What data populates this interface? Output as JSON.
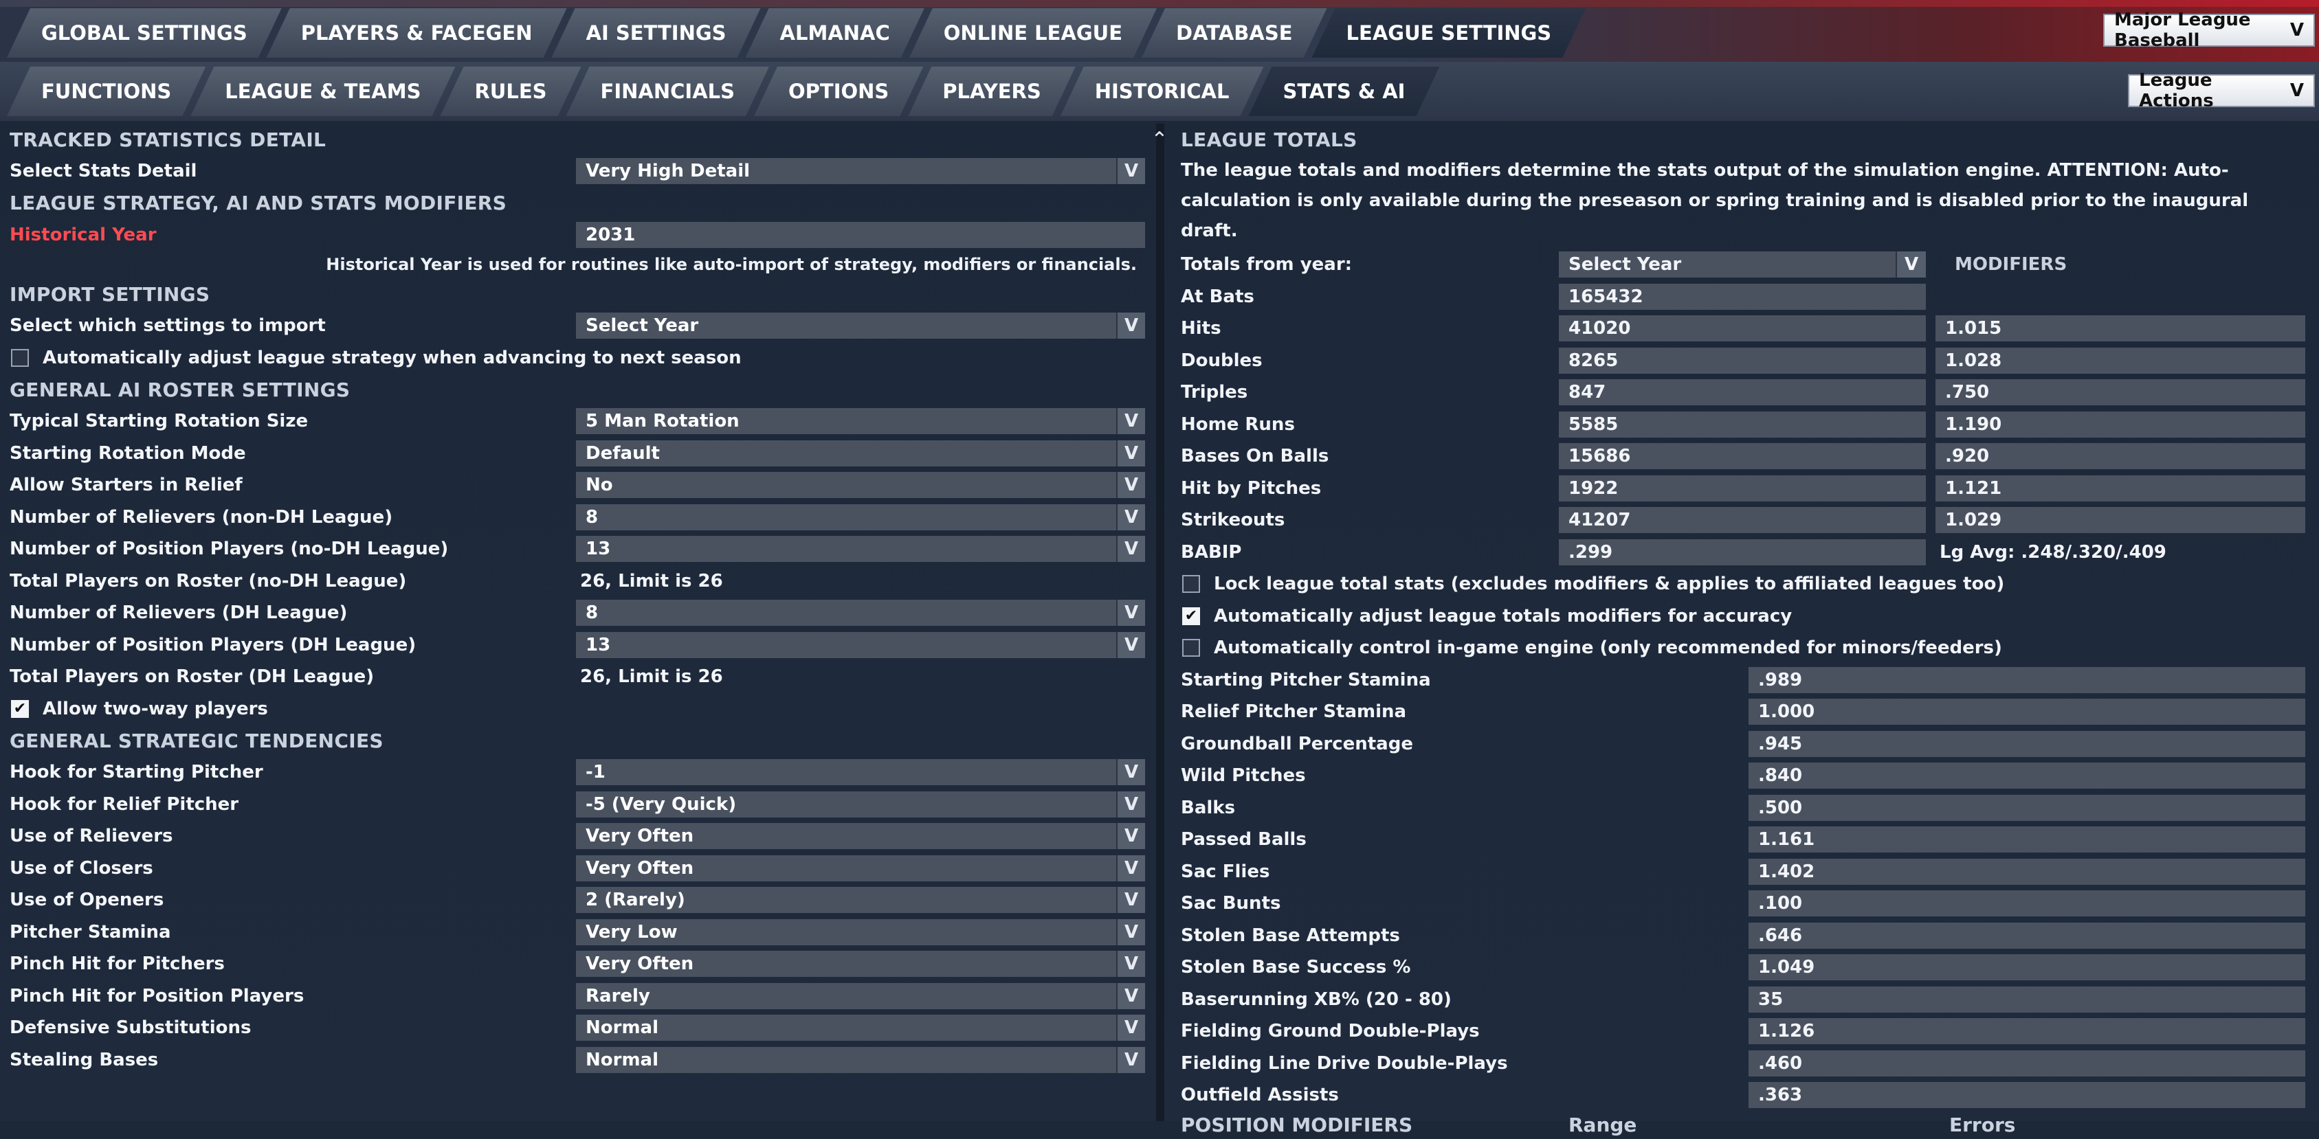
{
  "top_tabs": [
    "GLOBAL SETTINGS",
    "PLAYERS & FACEGEN",
    "AI SETTINGS",
    "ALMANAC",
    "ONLINE LEAGUE",
    "DATABASE",
    "LEAGUE SETTINGS"
  ],
  "sub_tabs": [
    "FUNCTIONS",
    "LEAGUE & TEAMS",
    "RULES",
    "FINANCIALS",
    "OPTIONS",
    "PLAYERS",
    "HISTORICAL",
    "STATS & AI"
  ],
  "league_select": {
    "value": "Major League Baseball",
    "chevron": "V"
  },
  "league_actions": {
    "label": "League Actions",
    "chevron": "V"
  },
  "left": {
    "tracked_title": "TRACKED STATISTICS DETAIL",
    "stats_detail": {
      "label": "Select Stats Detail",
      "value": "Very High Detail"
    },
    "strategy_title": "LEAGUE STRATEGY, AI AND STATS MODIFIERS",
    "historical_year": {
      "label": "Historical Year",
      "value": "2031"
    },
    "historical_note": "Historical Year is used for routines like auto-import of strategy, modifiers or financials.",
    "import_title": "IMPORT SETTINGS",
    "import_select": {
      "label": "Select which settings to import",
      "value": "Select Year"
    },
    "auto_adjust": "Automatically adjust league strategy when advancing to next season",
    "roster_title": "GENERAL AI ROSTER SETTINGS",
    "roster_rows": [
      {
        "label": "Typical Starting Rotation Size",
        "value": "5 Man Rotation",
        "dd": true
      },
      {
        "label": "Starting Rotation Mode",
        "value": "Default",
        "dd": true
      },
      {
        "label": "Allow Starters in Relief",
        "value": "No",
        "dd": true
      },
      {
        "label": "Number of Relievers (non-DH League)",
        "value": "8",
        "dd": true
      },
      {
        "label": "Number of Position Players (no-DH League)",
        "value": "13",
        "dd": true
      },
      {
        "label": "Total Players on Roster (no-DH League)",
        "value": "26, Limit is 26",
        "dd": false
      },
      {
        "label": "Number of Relievers (DH League)",
        "value": "8",
        "dd": true
      },
      {
        "label": "Number of Position Players (DH League)",
        "value": "13",
        "dd": true
      },
      {
        "label": "Total Players on Roster (DH League)",
        "value": "26, Limit is 26",
        "dd": false
      }
    ],
    "two_way": "Allow two-way players",
    "tendencies_title": "GENERAL STRATEGIC TENDENCIES",
    "tendency_rows": [
      {
        "label": "Hook for Starting Pitcher",
        "value": "-1"
      },
      {
        "label": "Hook for Relief Pitcher",
        "value": "-5 (Very Quick)"
      },
      {
        "label": "Use of Relievers",
        "value": "Very Often"
      },
      {
        "label": "Use of Closers",
        "value": "Very Often"
      },
      {
        "label": "Use of Openers",
        "value": "2 (Rarely)"
      },
      {
        "label": "Pitcher Stamina",
        "value": "Very Low"
      },
      {
        "label": "Pinch Hit for Pitchers",
        "value": "Very Often"
      },
      {
        "label": "Pinch Hit for Position Players",
        "value": "Rarely"
      },
      {
        "label": "Defensive Substitutions",
        "value": "Normal"
      },
      {
        "label": "Stealing Bases",
        "value": "Normal"
      }
    ],
    "dd_arrow": "V"
  },
  "right": {
    "totals_title": "LEAGUE TOTALS",
    "totals_desc": "The league totals and modifiers determine the stats output of the simulation engine. ATTENTION: Auto-calculation is only available during the preseason or spring training and is disabled prior to the inaugural draft.",
    "totals_from": {
      "label": "Totals from year:",
      "value": "Select Year"
    },
    "modifiers_header": "MODIFIERS",
    "at_bats": {
      "label": "At Bats",
      "value": "165432"
    },
    "total_rows": [
      {
        "label": "Hits",
        "value": "41020",
        "mod": "1.015"
      },
      {
        "label": "Doubles",
        "value": "8265",
        "mod": "1.028"
      },
      {
        "label": "Triples",
        "value": "847",
        "mod": ".750"
      },
      {
        "label": "Home Runs",
        "value": "5585",
        "mod": "1.190"
      },
      {
        "label": "Bases On Balls",
        "value": "15686",
        "mod": ".920"
      },
      {
        "label": "Hit by Pitches",
        "value": "1922",
        "mod": "1.121"
      },
      {
        "label": "Strikeouts",
        "value": "41207",
        "mod": "1.029"
      }
    ],
    "babip": {
      "label": "BABIP",
      "value": ".299",
      "lg_avg": "Lg Avg: .248/.320/.409"
    },
    "checks": [
      {
        "label": "Lock league total stats (excludes modifiers & applies to affiliated leagues too)",
        "checked": false
      },
      {
        "label": "Automatically adjust league totals modifiers for accuracy",
        "checked": true
      },
      {
        "label": "Automatically control in-game engine (only recommended for minors/feeders)",
        "checked": false
      }
    ],
    "engine_rows": [
      {
        "label": "Starting Pitcher Stamina",
        "value": ".989"
      },
      {
        "label": "Relief Pitcher Stamina",
        "value": "1.000"
      },
      {
        "label": "Groundball Percentage",
        "value": ".945"
      },
      {
        "label": "Wild Pitches",
        "value": ".840"
      },
      {
        "label": "Balks",
        "value": ".500"
      },
      {
        "label": "Passed Balls",
        "value": "1.161"
      },
      {
        "label": "Sac Flies",
        "value": "1.402"
      },
      {
        "label": "Sac Bunts",
        "value": ".100"
      },
      {
        "label": "Stolen Base Attempts",
        "value": ".646"
      },
      {
        "label": "Stolen Base Success %",
        "value": "1.049"
      },
      {
        "label": "Baserunning XB% (20 - 80)",
        "value": "35"
      },
      {
        "label": "Fielding Ground Double-Plays",
        "value": "1.126"
      },
      {
        "label": "Fielding Line Drive Double-Plays",
        "value": ".460"
      },
      {
        "label": "Outfield Assists",
        "value": ".363"
      }
    ],
    "position_title": "POSITION MODIFIERS",
    "range_header": "Range",
    "errors_header": "Errors"
  }
}
